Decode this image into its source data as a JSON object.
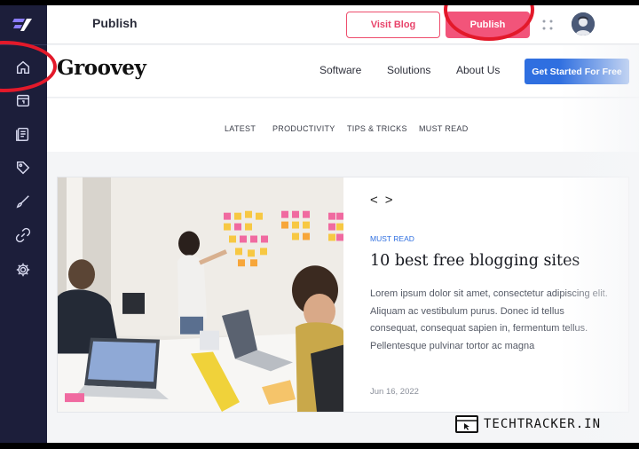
{
  "sidebar": {
    "items": [
      {
        "name": "home-icon"
      },
      {
        "name": "calendar-icon"
      },
      {
        "name": "pages-icon"
      },
      {
        "name": "tag-icon"
      },
      {
        "name": "brush-icon"
      },
      {
        "name": "link-icon"
      },
      {
        "name": "gear-icon"
      }
    ],
    "active": "home-icon"
  },
  "topbar": {
    "title": "Publish",
    "visit_label": "Visit Blog",
    "publish_label": "Publish"
  },
  "site": {
    "logo": "Groovey",
    "nav": [
      "Software",
      "Solutions",
      "About Us"
    ],
    "cta_label": "Get Started For Free",
    "categories": [
      "LATEST",
      "PRODUCTIVITY",
      "TIPS & TRICKS",
      "MUST READ"
    ]
  },
  "post": {
    "arrows": "< >",
    "tag": "MUST READ",
    "title": "10 best free blogging sites",
    "excerpt": "Lorem ipsum dolor sit amet, consectetur adipiscing elit. Aliquam ac vestibulum purus. Donec id tellus consequat, consequat sapien in, fermentum tellus. Pellentesque pulvinar tortor ac magna",
    "date": "Jun 16, 2022"
  },
  "watermark": "TECHTRACKER.IN",
  "colors": {
    "sidebar": "#1c1e3a",
    "accent_pink": "#f2547a",
    "cta_blue": "#2f6fe0",
    "annotation_red": "#e3192a"
  }
}
